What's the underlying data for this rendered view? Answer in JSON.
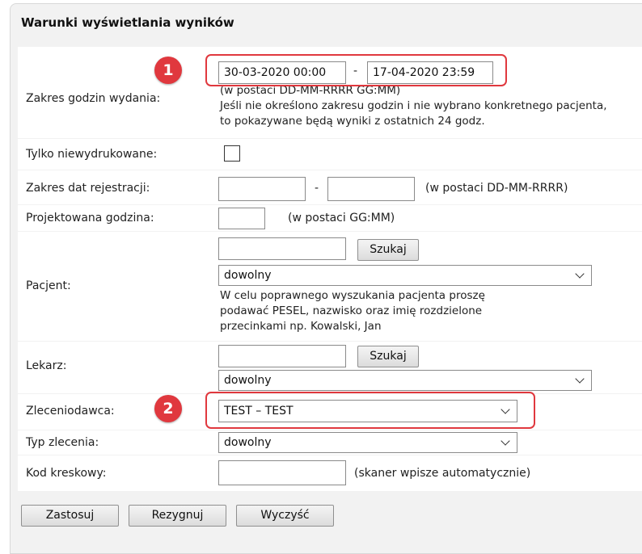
{
  "panel": {
    "title": "Warunki wyświetlania wyników"
  },
  "release_hours": {
    "label": "Zakres godzin wydania:",
    "from_value": "30-03-2020 00:00",
    "separator": "-",
    "to_value": "17-04-2020 23:59",
    "format_note": "(w postaci DD-MM-RRRR GG:MM)",
    "info_line1": "Jeśli nie określono zakresu godzin i nie wybrano konkretnego pacjenta,",
    "info_line2": "to pokazywane będą wyniki z ostatnich 24 godz.",
    "badge": "1"
  },
  "unprinted_only": {
    "label": "Tylko niewydrukowane:",
    "checked": false
  },
  "registration_dates": {
    "label": "Zakres dat rejestracji:",
    "from_value": "",
    "separator": "-",
    "to_value": "",
    "format_note": "(w postaci DD-MM-RRRR)"
  },
  "projected_hour": {
    "label": "Projektowana godzina:",
    "value": "",
    "format_note": "(w postaci GG:MM)"
  },
  "patient": {
    "label": "Pacjent:",
    "search_value": "",
    "search_button": "Szukaj",
    "select_value": "dowolny",
    "info_line1": "W celu poprawnego wyszukania pacjenta proszę",
    "info_line2": "podawać PESEL, nazwisko oraz imię rozdzielone",
    "info_line3": "przecinkami np. Kowalski, Jan"
  },
  "doctor": {
    "label": "Lekarz:",
    "search_value": "",
    "search_button": "Szukaj",
    "select_value": "dowolny"
  },
  "orderer": {
    "label": "Zleceniodawca:",
    "select_value": "TEST – TEST",
    "badge": "2"
  },
  "order_type": {
    "label": "Typ zlecenia:",
    "select_value": "dowolny"
  },
  "barcode": {
    "label": "Kod kreskowy:",
    "value": "",
    "note": "(skaner wpisze automatycznie)"
  },
  "actions": {
    "apply": "Zastosuj",
    "cancel": "Rezygnuj",
    "clear": "Wyczyść"
  },
  "colors": {
    "highlight": "#e0383e",
    "panel_bg": "#f2f2f2",
    "row_bg": "#ffffff"
  }
}
